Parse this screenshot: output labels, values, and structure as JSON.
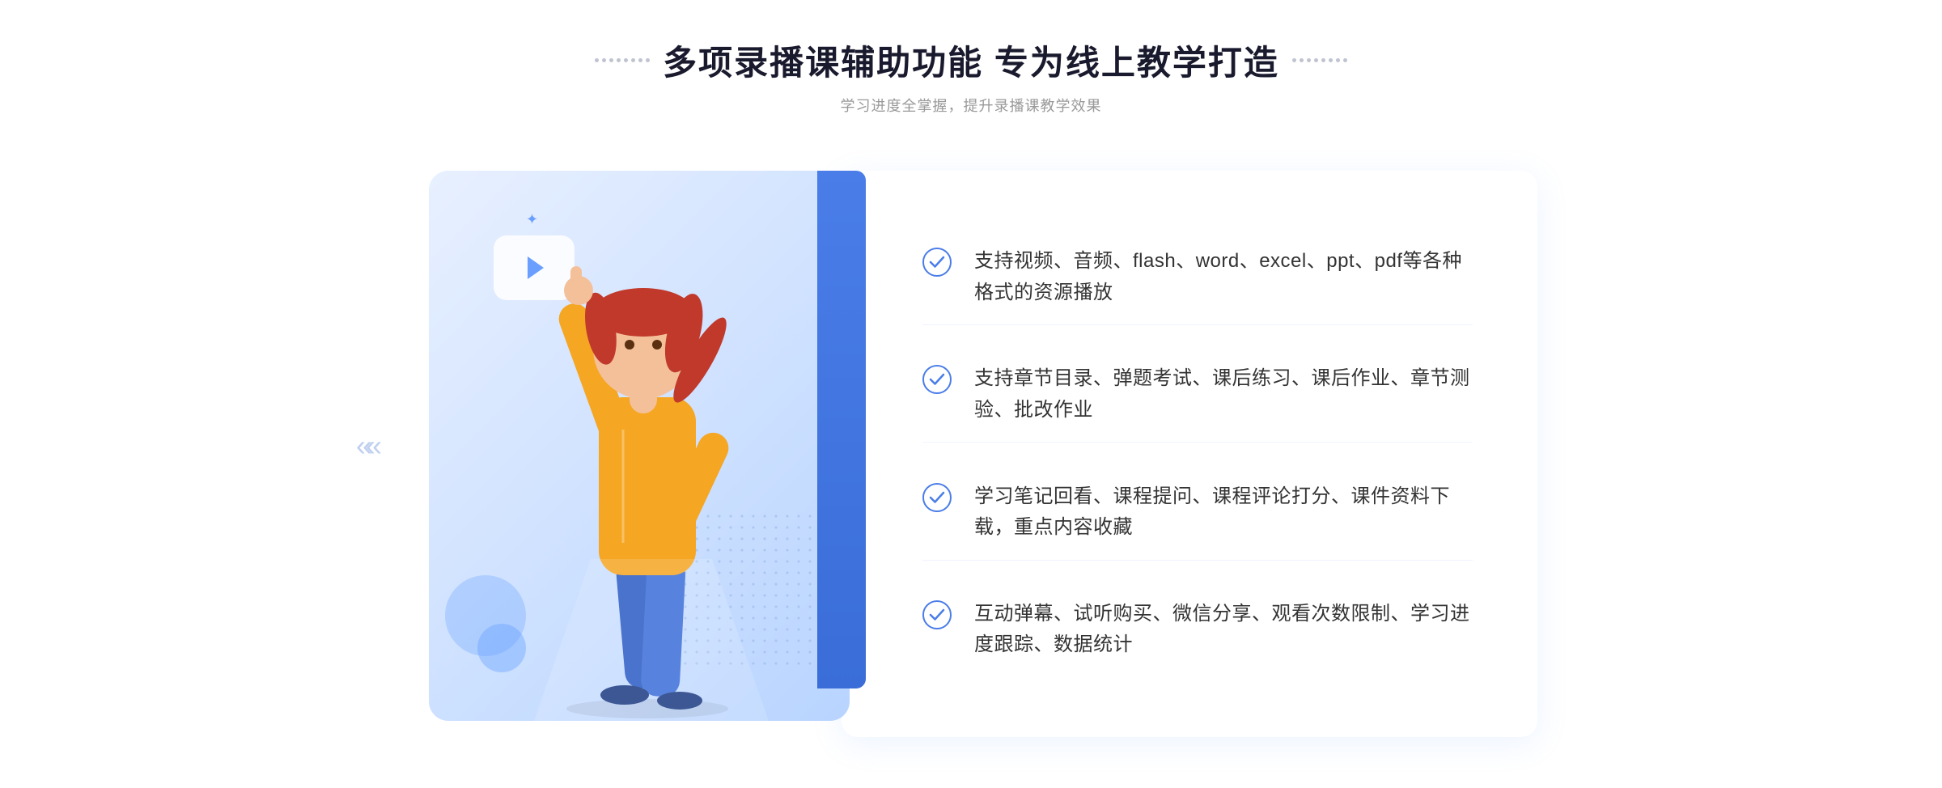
{
  "header": {
    "title": "多项录播课辅助功能 专为线上教学打造",
    "subtitle": "学习进度全掌握，提升录播课教学效果"
  },
  "features": [
    {
      "id": 1,
      "text": "支持视频、音频、flash、word、excel、ppt、pdf等各种格式的资源播放"
    },
    {
      "id": 2,
      "text": "支持章节目录、弹题考试、课后练习、课后作业、章节测验、批改作业"
    },
    {
      "id": 3,
      "text": "学习笔记回看、课程提问、课程评论打分、课件资料下载，重点内容收藏"
    },
    {
      "id": 4,
      "text": "互动弹幕、试听购买、微信分享、观看次数限制、学习进度跟踪、数据统计"
    }
  ],
  "icons": {
    "check": "check-circle-icon",
    "play": "play-icon",
    "dots_left": "decorative-dots-left",
    "dots_right": "decorative-dots-right",
    "chevron": "chevron-left-icon"
  },
  "colors": {
    "primary": "#4a7de8",
    "primary_light": "#6a9fff",
    "bg_gradient_start": "#e8f0ff",
    "bg_gradient_end": "#b8d4ff",
    "text_dark": "#1a1a2e",
    "text_medium": "#333333",
    "text_light": "#999999",
    "check_color": "#4a7de8"
  }
}
